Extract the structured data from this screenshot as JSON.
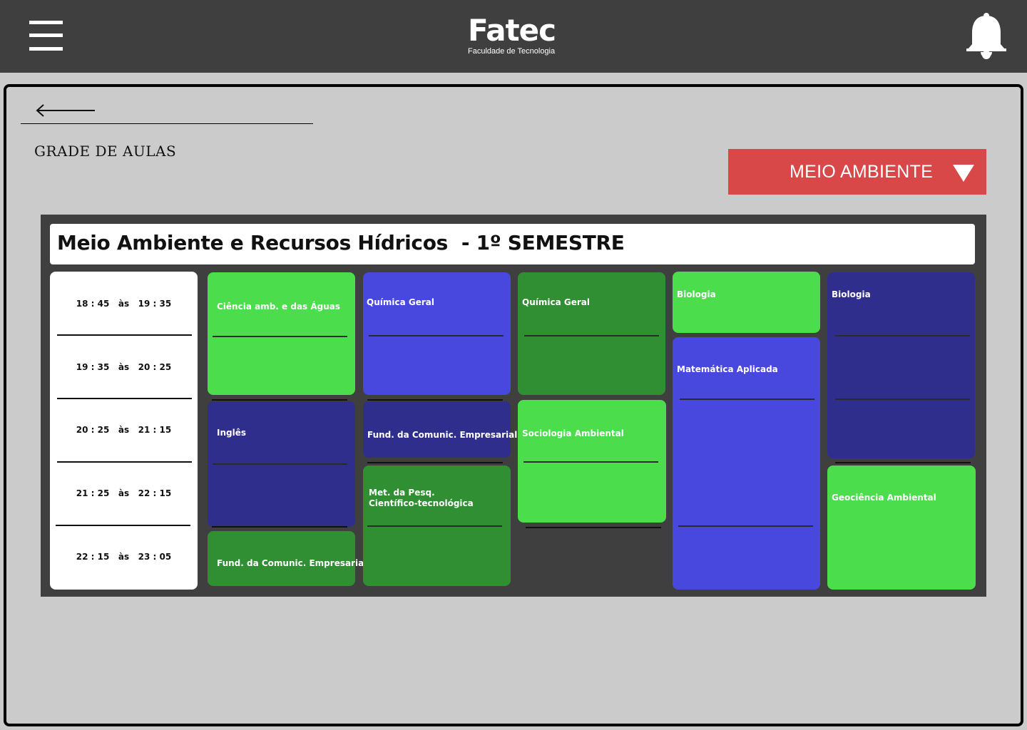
{
  "header": {
    "logo_main": "Fatec",
    "logo_sub": "Faculdade de Tecnologia"
  },
  "page": {
    "title": "GRADE DE AULAS"
  },
  "course_select": {
    "value": "MEIO AMBIENTE"
  },
  "schedule": {
    "title": "Meio Ambiente e Recursos Hídricos  - 1º SEMESTRE",
    "times": [
      "18 : 45   às   19 : 35",
      "19 : 35   às   20 : 25",
      "20 : 25   às   21 : 15",
      "21 : 25   às   22 : 15",
      "22 : 15   às   23 : 05"
    ],
    "classes": {
      "c1_1": "Ciência amb. e das Águas",
      "c1_2": "Inglês",
      "c1_3": "Fund. da Comunic. Empresarial",
      "c2_1": "Química Geral",
      "c2_2": "Fund. da Comunic. Empresarial",
      "c2_3": "Met. da Pesq.\nCientífico-tecnológica",
      "c3_1": "Química Geral",
      "c3_2": "Sociologia Ambiental",
      "c4_1": "Biologia",
      "c4_2": "Matemática Aplicada",
      "c5_1": "Biologia",
      "c5_2": "Geociência Ambiental"
    }
  },
  "colors": {
    "topbar": "#3f3f3f",
    "select": "#d94848",
    "green_light": "#4bdd4b",
    "green_dark": "#2f8f32",
    "blue_light": "#4848de",
    "blue_dark": "#2f2e8c"
  }
}
